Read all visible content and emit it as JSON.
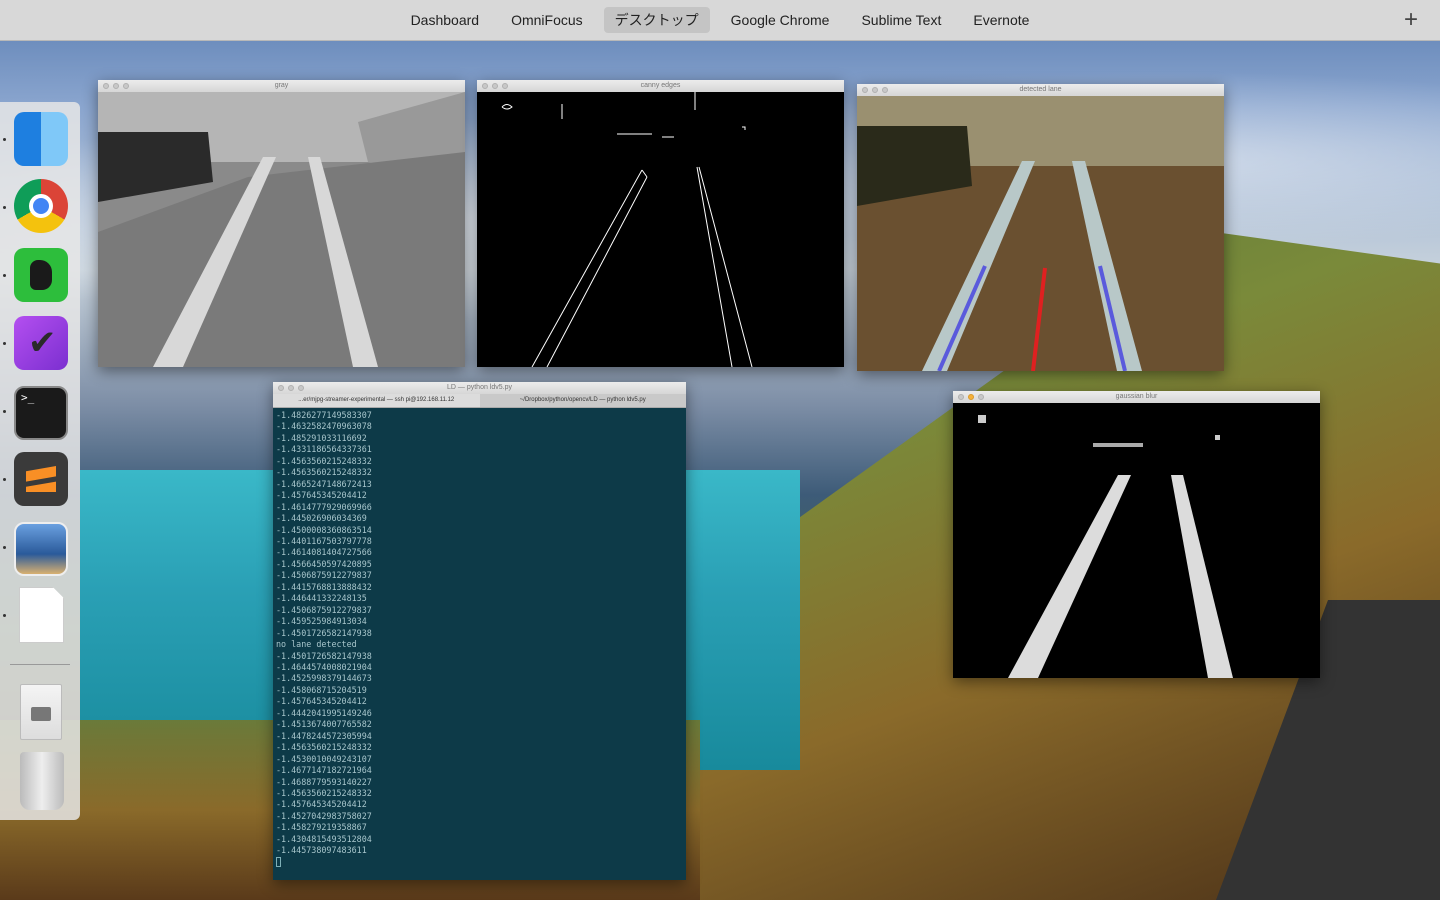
{
  "menubar": {
    "tabs": [
      {
        "label": "Dashboard",
        "active": false
      },
      {
        "label": "OmniFocus",
        "active": false
      },
      {
        "label": "デスクトップ",
        "active": true
      },
      {
        "label": "Google Chrome",
        "active": false
      },
      {
        "label": "Sublime Text",
        "active": false
      },
      {
        "label": "Evernote",
        "active": false
      }
    ],
    "add_icon": "+"
  },
  "dock": {
    "items": [
      "finder-icon",
      "chrome-icon",
      "evernote-icon",
      "omnifocus-icon",
      "terminal-icon",
      "sublime-text-icon",
      "preview-icon",
      "document-icon",
      "disk-utility-icon",
      "trash-icon"
    ]
  },
  "windows": {
    "gray": {
      "title": "gray"
    },
    "canny": {
      "title": "canny edges"
    },
    "lane": {
      "title": "detected lane"
    },
    "blur": {
      "title": "gaussian blur"
    }
  },
  "terminal": {
    "title": "LD — python ldv5.py",
    "tab1": "...er/mjpg-streamer-experimental — ssh pi@192.168.11.12",
    "tab2": "~/Dropbox/python/opencv/LD — python ldv5.py",
    "lines": [
      "-1.4826277149583307",
      "-1.4632582470963078",
      "-1.485291033116692",
      "-1.4331186564337361",
      "-1.4563560215248332",
      "-1.4563560215248332",
      "-1.4665247148672413",
      "-1.457645345204412",
      "-1.4614777929069966",
      "-1.445026906034369",
      "-1.4500008360863514",
      "-1.4401167503797778",
      "-1.4614081404727566",
      "-1.4566450597420895",
      "-1.4506875912279837",
      "-1.4415768813888432",
      "-1.446441332248135",
      "-1.4506875912279837",
      "-1.459525984913034",
      "-1.4501726582147938",
      "no lane detected",
      "-1.4501726582147938",
      "-1.4644574008021904",
      "-1.4525998379144673",
      "-1.458068715204519",
      "-1.457645345204412",
      "-1.4442041995149246",
      "-1.4513674007765582",
      "-1.4478244572305994",
      "-1.4563560215248332",
      "-1.4530010049243107",
      "-1.4677147182721964",
      "-1.4688779593140227",
      "-1.4563560215248332",
      "-1.457645345204412",
      "-1.4527042983758027",
      "-1.458279219358867",
      "-1.4304815493512804",
      "-1.445738097483611"
    ]
  }
}
